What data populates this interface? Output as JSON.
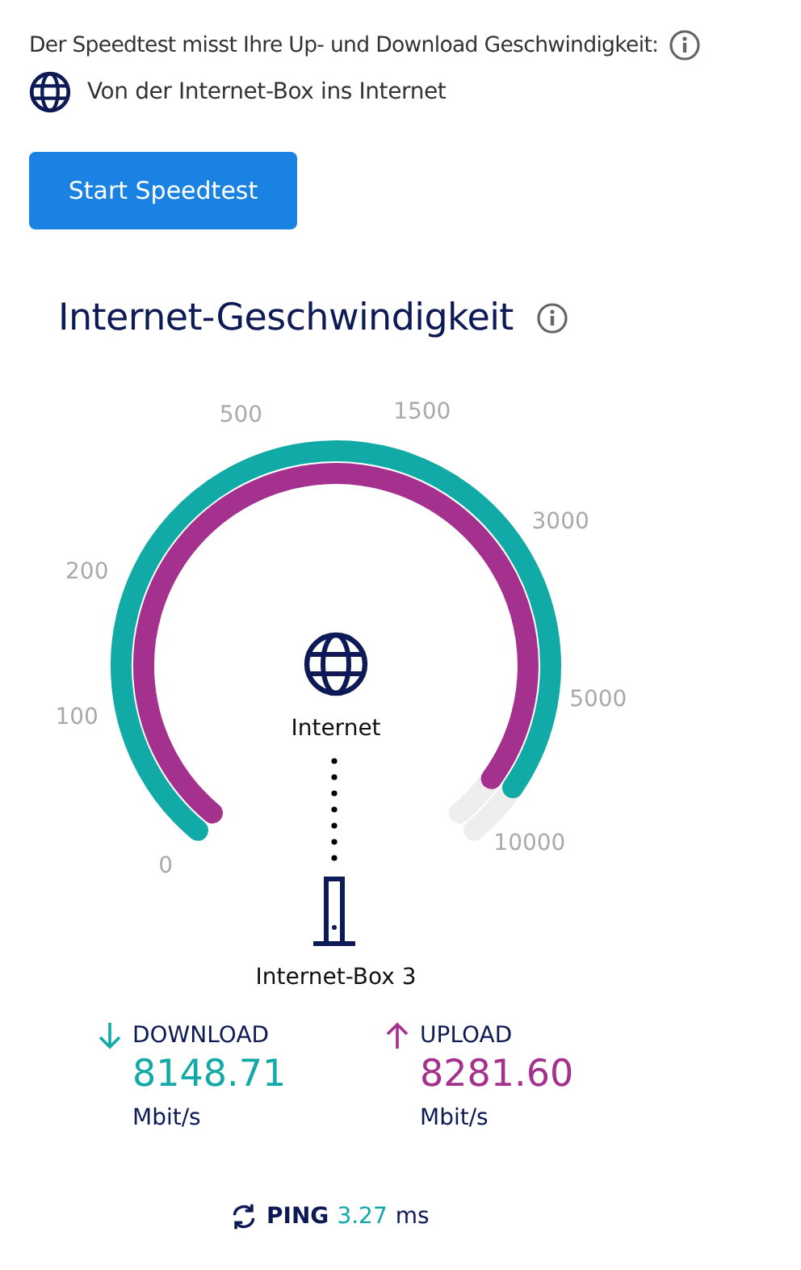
{
  "intro": {
    "text": "Der Speedtest misst Ihre Up- und Download Geschwindigkeit:",
    "subtext": "Von der Internet-Box ins Internet"
  },
  "start_button": "Start Speedtest",
  "section_title": "Internet-Geschwindigkeit",
  "gauge": {
    "scale_labels": [
      "0",
      "100",
      "200",
      "500",
      "1500",
      "3000",
      "5000",
      "10000"
    ],
    "top_node": "Internet",
    "bottom_node": "Internet-Box 3"
  },
  "results": [
    {
      "kind": "download",
      "label": "DOWNLOAD",
      "value": "8148.71",
      "unit": "Mbit/s",
      "color": "#12aaa6"
    },
    {
      "kind": "upload",
      "label": "UPLOAD",
      "value": "8281.60",
      "unit": "Mbit/s",
      "color": "#a5318f"
    }
  ],
  "ping": {
    "label": "PING",
    "value": "3.27",
    "unit": "ms"
  }
}
